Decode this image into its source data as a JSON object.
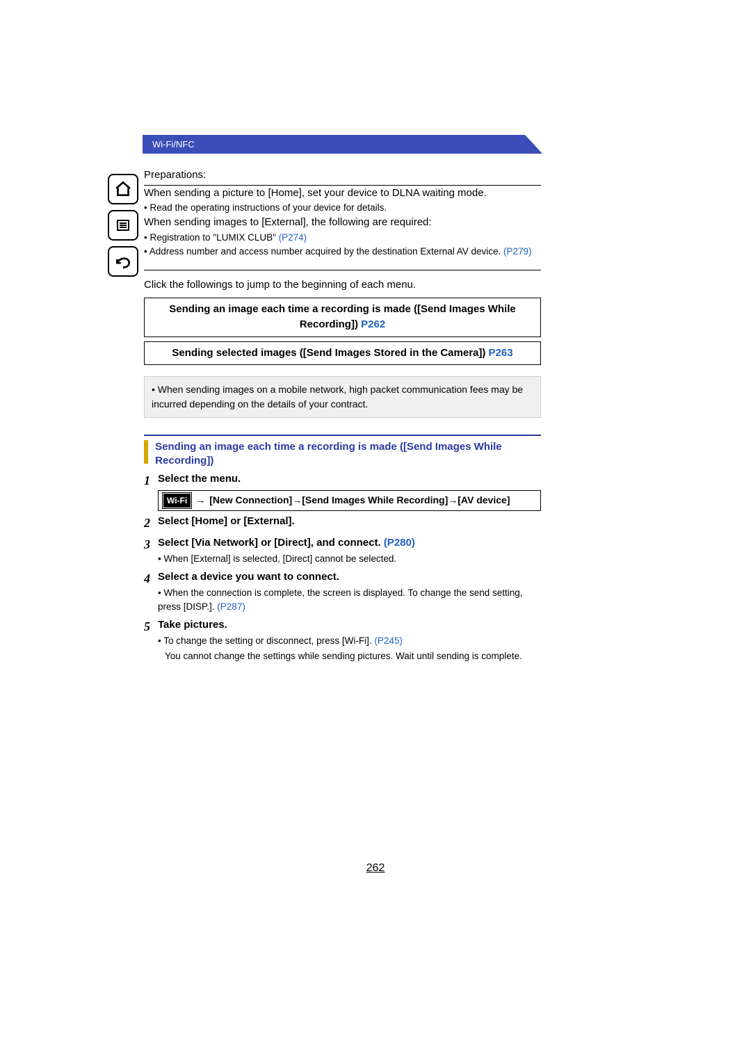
{
  "header": {
    "title": "Wi-Fi/NFC"
  },
  "nav": {
    "home": "home-icon",
    "menu": "menu-icon",
    "back": "back-icon"
  },
  "prep": {
    "title": "Preparations:",
    "line1": "When sending a picture to [Home], set your device to DLNA waiting mode.",
    "bullet1": "• Read the operating instructions of your device for details.",
    "line2": "When sending images to [External], the following are required:",
    "bullet2a": "• Registration to \"LUMIX CLUB\" ",
    "bullet2a_link": "(P274)",
    "bullet2b": "• Address number and access number acquired by the destination External AV device. ",
    "bullet2b_link": "(P279)"
  },
  "jump": {
    "text": "Click the followings to jump to the beginning of each menu.",
    "box1_text": "Sending an image each time a recording is made ([Send Images While Recording]) ",
    "box1_link": "P262",
    "box2_text": "Sending selected images ([Send Images Stored in the Camera]) ",
    "box2_link": "P263"
  },
  "note": "• When sending images on a mobile network, high packet communication fees may be incurred depending on the details of your contract.",
  "section_heading": "Sending an image each time a recording is made ([Send Images While Recording])",
  "steps": {
    "s1": {
      "num": "1",
      "title": "Select the menu.",
      "wifi_label": "Wi-Fi",
      "arrow": "→",
      "path": "[New Connection]→[Send Images While Recording]→[AV device]"
    },
    "s2": {
      "num": "2",
      "title": "Select [Home] or [External]."
    },
    "s3": {
      "num": "3",
      "title": "Select [Via Network] or [Direct], and connect. ",
      "title_link": "(P280)",
      "sub": "• When [External] is selected, [Direct] cannot be selected."
    },
    "s4": {
      "num": "4",
      "title": "Select a device you want to connect.",
      "sub": "• When the connection is complete, the screen is displayed. To change the send setting, press [DISP.]. ",
      "sub_link": "(P287)"
    },
    "s5": {
      "num": "5",
      "title": "Take pictures.",
      "sub1": "• To change the setting or disconnect, press [Wi-Fi]. ",
      "sub1_link": "(P245)",
      "sub2": "You cannot change the settings while sending pictures. Wait until sending is complete."
    }
  },
  "page_number": "262"
}
